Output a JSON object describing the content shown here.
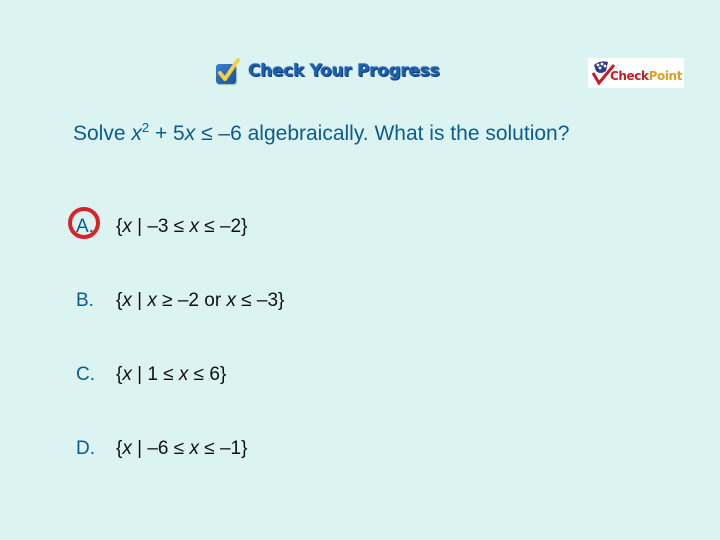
{
  "header": {
    "title": "Check Your Progress",
    "title_icon": "checkbox-checked-icon",
    "logo": {
      "icon": "checkpoint-logo-icon",
      "text_part1": "Check",
      "text_part2": "Point",
      "colors": {
        "check": "#c0202a",
        "point": "#e0a020"
      }
    }
  },
  "question": {
    "prefix": "Solve ",
    "var": "x",
    "exponent": "2",
    "middle": " + 5",
    "var2": "x",
    "suffix": " ≤ –6 algebraically. What is the solution?"
  },
  "options": [
    {
      "letter": "A.",
      "open": "{",
      "var1": "x",
      "mid": " | –3 ≤ ",
      "var2": "x",
      "close": " ≤ –2}",
      "selected": true
    },
    {
      "letter": "B.",
      "open": "{",
      "var1": "x",
      "mid": " | ",
      "var2": "x",
      "mid2": " ≥ –2 or ",
      "var3": "x",
      "close": " ≤ –3}",
      "selected": false
    },
    {
      "letter": "C.",
      "open": "{",
      "var1": "x",
      "mid": " | 1 ≤ ",
      "var2": "x",
      "close": " ≤ 6}",
      "selected": false
    },
    {
      "letter": "D.",
      "open": "{",
      "var1": "x",
      "mid": " | –6 ≤ ",
      "var2": "x",
      "close": " ≤ –1}",
      "selected": false
    }
  ],
  "colors": {
    "background": "#dcf4f1",
    "question_text": "#0d5b8c",
    "answer_text": "#111111",
    "selection_circle": "#d9222a"
  }
}
